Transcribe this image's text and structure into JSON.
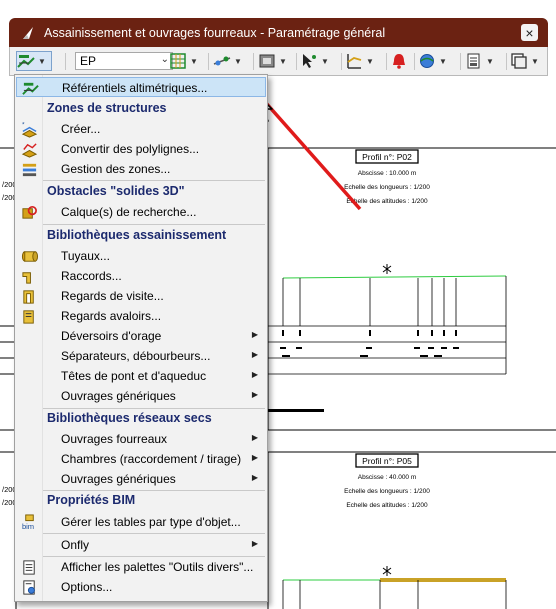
{
  "window": {
    "title": "Assainissement et ouvrages fourreaux - Paramétrage général",
    "close_symbol": "×"
  },
  "toolbar": {
    "combo_value": "EP",
    "combo_arrow": "⌄"
  },
  "menu": {
    "items": [
      {
        "label": "Référentiels altimétriques...",
        "highlighted": true
      },
      {
        "heading": "Zones de structures"
      },
      {
        "label": "Créer..."
      },
      {
        "label": "Convertir des polylignes..."
      },
      {
        "label": "Gestion des zones..."
      },
      {
        "heading": "Obstacles \"solides 3D\""
      },
      {
        "label": "Calque(s) de recherche..."
      },
      {
        "heading": "Bibliothèques assainissement"
      },
      {
        "label": "Tuyaux..."
      },
      {
        "label": "Raccords..."
      },
      {
        "label": "Regards de visite..."
      },
      {
        "label": "Regards avaloirs..."
      },
      {
        "label": "Déversoirs d'orage",
        "submenu": true
      },
      {
        "label": "Séparateurs, débourbeurs...",
        "submenu": true
      },
      {
        "label": "Têtes de pont et d'aqueduc",
        "submenu": true
      },
      {
        "label": "Ouvrages génériques",
        "submenu": true
      },
      {
        "heading": "Bibliothèques réseaux secs"
      },
      {
        "label": "Ouvrages fourreaux",
        "submenu": true
      },
      {
        "label": "Chambres (raccordement / tirage)",
        "submenu": true
      },
      {
        "label": "Ouvrages génériques",
        "submenu": true
      },
      {
        "heading": "Propriétés BIM"
      },
      {
        "label": "Gérer les tables par type d'objet..."
      },
      {
        "label": "Onfly",
        "submenu": true
      },
      {
        "label": "Afficher les palettes \"Outils divers\"..."
      },
      {
        "label": "Options..."
      }
    ],
    "submenu_arrow": "▶",
    "bim_icon_text": "bim"
  },
  "drawing": {
    "profile1": {
      "title": "Profil n°: P02",
      "abscisse": "Abscisse : 10.000 m",
      "ech_long": "Echelle des longueurs : 1/200",
      "ech_alt": "Echelle des altitudes : 1/200"
    },
    "profile2": {
      "title": "Profil n°: P05",
      "abscisse": "Abscisse : 40.000 m",
      "ech_long": "Echelle des longueurs : 1/200",
      "ech_alt": "Echelle des altitudes : 1/200"
    },
    "left_frag_1a": "/200",
    "left_frag_1b": "/200",
    "left_frag_2a": "/200",
    "left_frag_2b": "/200"
  },
  "colors": {
    "titlebar": "#6b2212",
    "arrow": "#e01b1b",
    "heading": "#1c2a6e",
    "highlight": "#cce4f7",
    "ground_line": "#2ecc40"
  }
}
